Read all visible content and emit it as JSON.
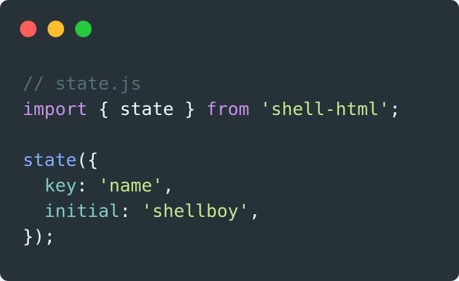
{
  "window": {
    "controls": [
      {
        "name": "close",
        "color": "#ff5f56"
      },
      {
        "name": "minimize",
        "color": "#ffbd2e"
      },
      {
        "name": "maximize",
        "color": "#27c93f"
      }
    ]
  },
  "code": {
    "line1": {
      "comment": "// state.js"
    },
    "line2": {
      "kw_import": "import",
      "brace_open": " { ",
      "name": "state",
      "brace_close": " } ",
      "kw_from": "from",
      "space": " ",
      "module": "'shell-html'",
      "semi": ";"
    },
    "line3": "",
    "line4": {
      "fn": "state",
      "open": "({"
    },
    "line5": {
      "indent": "  ",
      "key": "key",
      "colon": ": ",
      "value": "'name'",
      "comma": ","
    },
    "line6": {
      "indent": "  ",
      "key": "initial",
      "colon": ": ",
      "value": "'shellboy'",
      "comma": ","
    },
    "line7": {
      "close": "});"
    }
  }
}
